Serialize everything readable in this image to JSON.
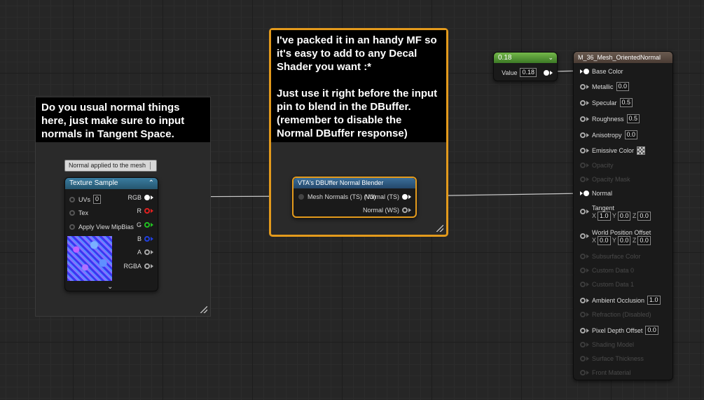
{
  "comments": {
    "left": "Do you usual normal things\nhere, just make sure to input\nnormals in Tangent Space.",
    "middle": "I've packed it in an handy MF so\nit's easy to add to any Decal\nShader you want :*\n\nJust use it right before the input\npin to blend in the DBuffer.\n(remember to disable the\nNormal DBuffer response)"
  },
  "note_bubble": "Normal applied to the mesh",
  "texture_sample": {
    "title": "Texture Sample",
    "inputs": [
      "UVs",
      "Tex",
      "Apply View MipBias"
    ],
    "uvs_value": "0",
    "outputs": [
      "RGB",
      "R",
      "G",
      "B",
      "A",
      "RGBA"
    ]
  },
  "blender": {
    "title": "VTA's DBUffer Normal Blender",
    "input": "Mesh Normals (TS) (V3)",
    "outputs": [
      "Normal (TS)",
      "Normal (WS)"
    ]
  },
  "scalar": {
    "title": "0.18",
    "label": "Value",
    "value": "0.18"
  },
  "material": {
    "title": "M_36_Mesh_OrientedNormal",
    "pins": {
      "base_color": "Base Color",
      "metallic": "Metallic",
      "metallic_val": "0.0",
      "specular": "Specular",
      "specular_val": "0.5",
      "roughness": "Roughness",
      "roughness_val": "0.5",
      "anisotropy": "Anisotropy",
      "anisotropy_val": "0.0",
      "emissive": "Emissive Color",
      "opacity": "Opacity",
      "opacity_mask": "Opacity Mask",
      "normal": "Normal",
      "tangent": "Tangent",
      "tangent_x": "1.0",
      "tangent_y": "0.0",
      "tangent_z": "0.0",
      "wpo": "World Position Offset",
      "wpo_x": "0.0",
      "wpo_y": "0.0",
      "wpo_z": "0.0",
      "subsurface": "Subsurface Color",
      "custom0": "Custom Data 0",
      "custom1": "Custom Data 1",
      "ao": "Ambient Occlusion",
      "ao_val": "1.0",
      "refraction": "Refraction (Disabled)",
      "pdo": "Pixel Depth Offset",
      "pdo_val": "0.0",
      "shading_model": "Shading Model",
      "surface_thickness": "Surface Thickness",
      "front_material": "Front Material"
    }
  },
  "colors": {
    "texture_header": "#2f6b8a",
    "blender_header": "#2d5c84",
    "scalar_header": "#5a9a3a",
    "material_header": "#5a4a42",
    "comment_highlight": "#e39a1c"
  }
}
